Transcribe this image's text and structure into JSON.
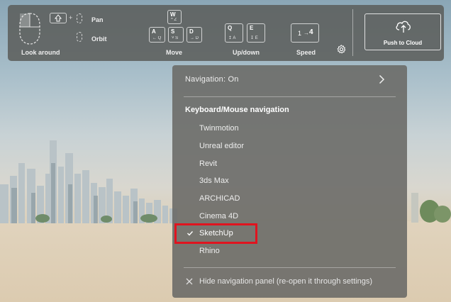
{
  "toolbar": {
    "look_around": "Look around",
    "pan": "Pan",
    "orbit": "Orbit",
    "move": "Move",
    "updown": "Up/down",
    "speed": "Speed",
    "speed_value_low": "1",
    "speed_value_high": "4",
    "push_to_cloud": "Push to Cloud",
    "keys": {
      "w": "W",
      "w_sub": "Z",
      "a": "A",
      "a_sub": "Q",
      "s": "S",
      "s_sub": "S",
      "d": "D",
      "d_sub": "D",
      "q": "Q",
      "q_sub": "A",
      "e": "E",
      "e_sub": "E"
    }
  },
  "panel": {
    "navigation_status": "Navigation: On",
    "section_title": "Keyboard/Mouse navigation",
    "items": [
      {
        "label": "Twinmotion",
        "selected": false
      },
      {
        "label": "Unreal editor",
        "selected": false
      },
      {
        "label": "Revit",
        "selected": false
      },
      {
        "label": "3ds Max",
        "selected": false
      },
      {
        "label": "ARCHICAD",
        "selected": false
      },
      {
        "label": "Cinema 4D",
        "selected": false
      },
      {
        "label": "SketchUp",
        "selected": true
      },
      {
        "label": "Rhino",
        "selected": false
      }
    ],
    "hide_label": "Hide navigation panel (re-open it through settings)"
  },
  "colors": {
    "highlight": "#e0141f",
    "panel_bg": "#6c6c68",
    "toolbar_bg": "#5c5e5c"
  },
  "icons": [
    "mouse-icon",
    "shift-key-icon",
    "cloud-upload-icon",
    "gear-icon",
    "chevron-right-icon",
    "check-icon",
    "close-icon"
  ]
}
